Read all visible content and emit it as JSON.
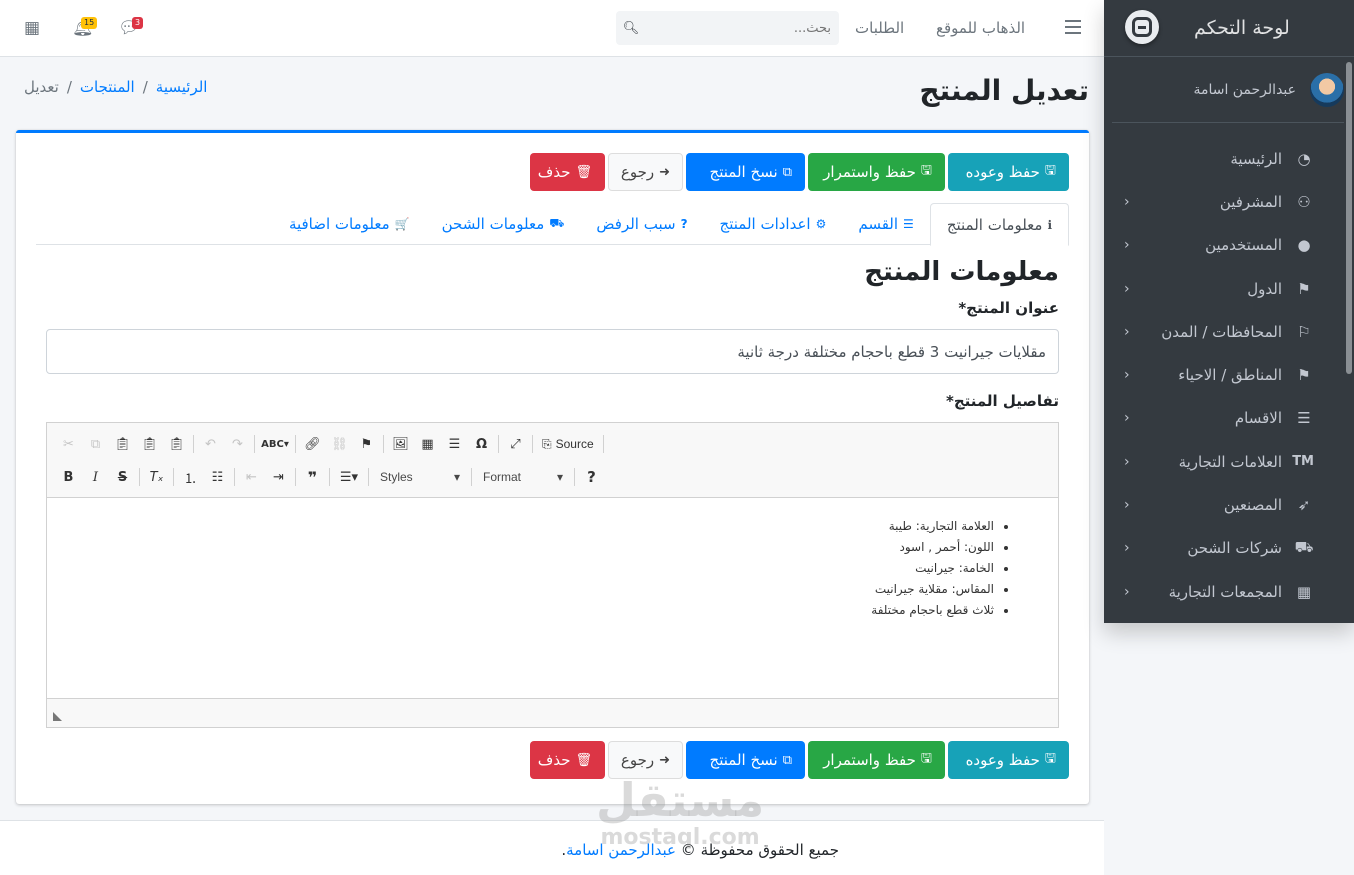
{
  "sidebar": {
    "brand": "لوحة التحكم",
    "user_name": "عبدالرحمن اسامة",
    "items": [
      {
        "label": "الرئيسية",
        "icon": "◔",
        "chevron": ""
      },
      {
        "label": "المشرفين",
        "icon": "⚇",
        "chevron": "‹"
      },
      {
        "label": "المستخدمين",
        "icon": "●",
        "chevron": "‹"
      },
      {
        "label": "الدول",
        "icon": "⚑",
        "chevron": "‹"
      },
      {
        "label": "المحافظات / المدن",
        "icon": "⚐",
        "chevron": "‹"
      },
      {
        "label": "المناطق / الاحياء",
        "icon": "⚑",
        "chevron": "‹"
      },
      {
        "label": "الاقسام",
        "icon": "☰",
        "chevron": "‹"
      },
      {
        "label": "العلامات التجارية",
        "icon": "TM",
        "chevron": "‹"
      },
      {
        "label": "المصنعين",
        "icon": "➶",
        "chevron": "‹"
      },
      {
        "label": "شركات الشحن",
        "icon": "⛟",
        "chevron": "‹"
      },
      {
        "label": "المجمعات التجارية",
        "icon": "▦",
        "chevron": "‹"
      }
    ]
  },
  "topbar": {
    "notifications_count": "15",
    "messages_count": "3",
    "search_placeholder": "بحث...",
    "orders_link": "الطلبات",
    "site_link": "الذهاب للموقع"
  },
  "page": {
    "title": "تعديل المنتج",
    "breadcrumb": {
      "home": "الرئيسية",
      "sep1": "/",
      "products": "المنتجات",
      "sep2": "/",
      "current": "تعديل"
    }
  },
  "actions": {
    "save_back": "حفظ وعوده",
    "save_continue": "حفظ واستمرار",
    "copy": "نسخ المنتج",
    "back": "رجوع",
    "delete": "حذف"
  },
  "tabs": [
    {
      "label": "معلومات المنتج",
      "icon": "ℹ"
    },
    {
      "label": "القسم",
      "icon": "☰"
    },
    {
      "label": "اعدادات المنتج",
      "icon": "⚙"
    },
    {
      "label": "سبب الرفض",
      "icon": "?"
    },
    {
      "label": "معلومات الشحن",
      "icon": "⛟"
    },
    {
      "label": "معلومات اضافية",
      "icon": "🛒"
    }
  ],
  "form": {
    "section_title": "معلومات المنتج",
    "title_label": "عنوان المنتج*",
    "title_value": "مقلايات جيرانيت 3 قطع باحجام مختلفة درجة ثانية",
    "details_label": "تفاصيل المنتج*"
  },
  "editor": {
    "source_label": "Source",
    "styles_label": "Styles",
    "format_label": "Format",
    "content": [
      "العلامة التجارية: طيبة",
      "اللون: أحمر , اسود",
      "الخامة: جيرانيت",
      "المقاس: مقلاية جيرانيت",
      "ثلاث قطع باحجام مختلفة"
    ]
  },
  "footer": {
    "text": "جميع الحقوق محفوظة ©",
    "author": "عبدالرحمن اسامة",
    "dot": "."
  },
  "watermark": {
    "line1": "مستقل",
    "line2": "mostaql.com"
  },
  "colors": {
    "primary": "#007bff",
    "info": "#17a2b8",
    "success": "#28a745",
    "danger": "#dc3545",
    "sidebar": "#343a40"
  }
}
